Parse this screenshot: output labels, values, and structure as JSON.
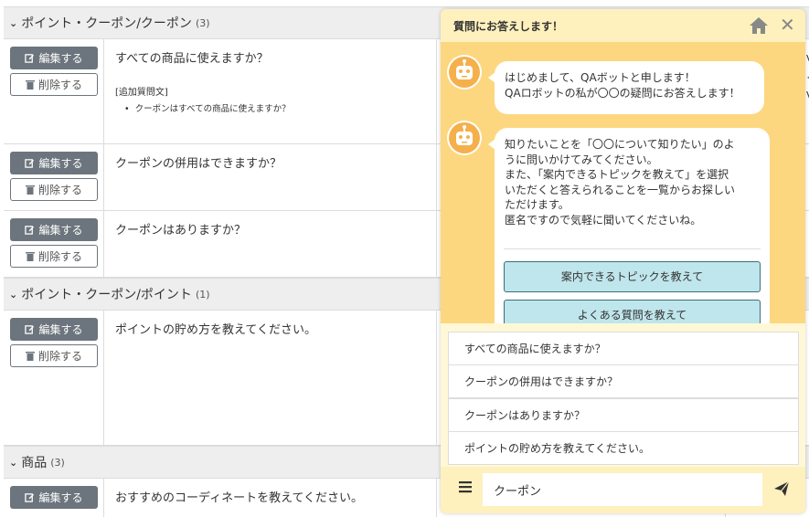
{
  "faq": {
    "groups": [
      {
        "title": "ポイント・クーポン/クーポン",
        "count": "(3)"
      },
      {
        "title": "ポイント・クーポン/ポイント",
        "count": "(1)"
      },
      {
        "title": "商品",
        "count": "(3)"
      }
    ],
    "edit_label": "編集する",
    "delete_label": "削除する",
    "rows": [
      {
        "question": "すべての商品に使えますか？",
        "extra_title": "[追加質問文]",
        "extra_item": "クーポンはすべての商品に使えますか？"
      },
      {
        "question": "クーポンの併用はできますか？"
      },
      {
        "question": "クーポンはありますか？"
      },
      {
        "question": "ポイントの貯め方を教えてください。"
      },
      {
        "question": "おすすめのコーディネートを教えてください。"
      }
    ],
    "edge_text": [
      "V",
      "{",
      "V"
    ]
  },
  "chat": {
    "title": "質問にお答えします！",
    "messages": [
      {
        "lines": [
          "はじめまして、QAボットと申します！",
          "QAロボットの私が〇〇の疑問にお答えします！"
        ]
      },
      {
        "lines": [
          "知りたいことを「〇〇について知りたい」のよ",
          "うに問いかけてみてください。",
          "また、「案内できるトピックを教えて」を選択",
          "いただくと答えられることを一覧からお探しい",
          "ただけます。",
          "匿名ですので気軽に聞いてくださいね。"
        ]
      }
    ],
    "topic_buttons": [
      "案内できるトピックを教えて",
      "よくある質問を教えて"
    ],
    "suggestions": [
      "すべての商品に使えますか？",
      "クーポンの併用はできますか？",
      "クーポンはありますか？",
      "ポイントの貯め方を教えてください。"
    ],
    "input_value": "クーポン",
    "colors": {
      "panel": "#fdd77f",
      "header": "#fff1bd",
      "topic_button": "#bfe6ec",
      "edit_button": "#6c757d"
    }
  }
}
